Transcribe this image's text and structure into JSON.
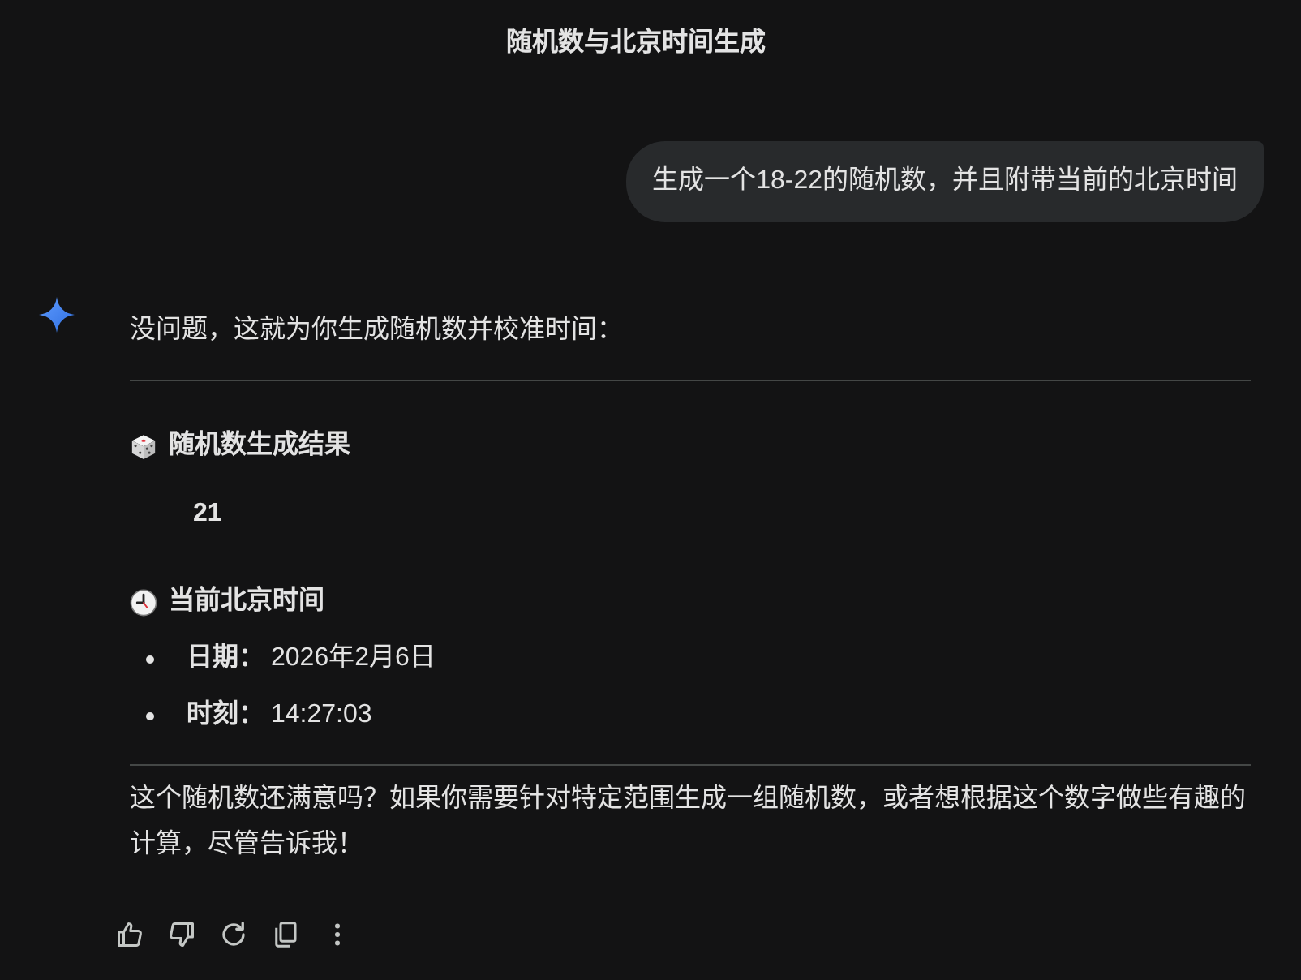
{
  "title": "随机数与北京时间生成",
  "user_message": "生成一个18-22的随机数，并且附带当前的北京时间",
  "response": [
    {
      "kind": "paragraph",
      "text": "没问题，这就为你生成随机数并校准时间："
    },
    {
      "kind": "rule"
    },
    {
      "kind": "heading",
      "text": "随机数生成结果"
    },
    {
      "kind": "result",
      "text": "21"
    },
    {
      "kind": "heading",
      "text": "当前北京时间"
    },
    {
      "kind": "list",
      "items": [
        {
          "label": "日期：",
          "value": "2026年2月6日"
        },
        {
          "label": "时刻：",
          "value": "14:27:03"
        }
      ]
    },
    {
      "kind": "rule"
    },
    {
      "kind": "paragraph",
      "text": "这个随机数还满意吗？如果你需要针对特定范围生成一组随机数，或者想根据这个数字做些有趣的计算，尽管告诉我！"
    }
  ]
}
